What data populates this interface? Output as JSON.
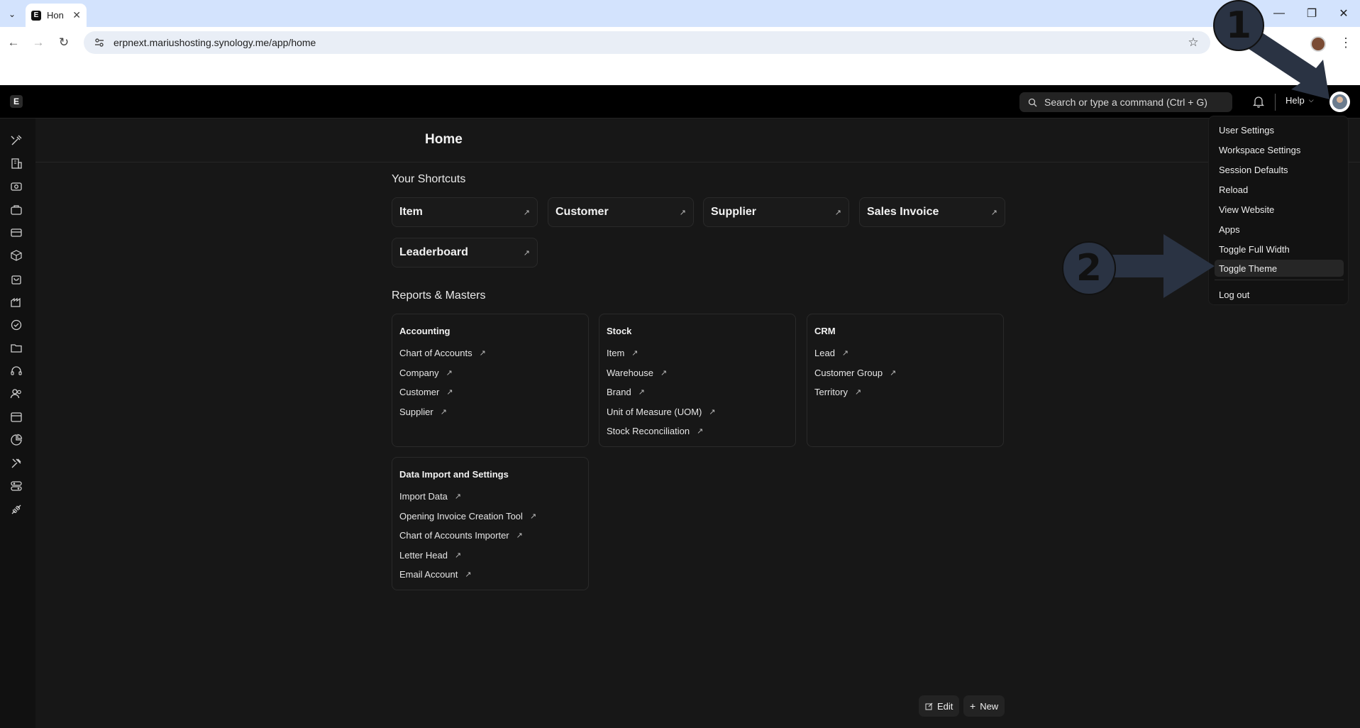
{
  "browser": {
    "tab_title": "Hon",
    "tab_favicon": "E",
    "url": "erpnext.mariushosting.synology.me/app/home"
  },
  "navbar": {
    "logo": "E",
    "search_placeholder": "Search or type a command (Ctrl + G)",
    "help_label": "Help"
  },
  "page": {
    "title": "Home"
  },
  "shortcuts": {
    "title": "Your Shortcuts",
    "items": [
      "Item",
      "Customer",
      "Supplier",
      "Sales Invoice",
      "Leaderboard"
    ]
  },
  "reports": {
    "title": "Reports & Masters",
    "cards": [
      {
        "title": "Accounting",
        "links": [
          "Chart of Accounts",
          "Company",
          "Customer",
          "Supplier"
        ]
      },
      {
        "title": "Stock",
        "links": [
          "Item",
          "Warehouse",
          "Brand",
          "Unit of Measure (UOM)",
          "Stock Reconciliation"
        ]
      },
      {
        "title": "CRM",
        "links": [
          "Lead",
          "Customer Group",
          "Territory"
        ]
      },
      {
        "title": "Data Import and Settings",
        "links": [
          "Import Data",
          "Opening Invoice Creation Tool",
          "Chart of Accounts Importer",
          "Letter Head",
          "Email Account"
        ]
      }
    ]
  },
  "user_menu": {
    "items": [
      "User Settings",
      "Workspace Settings",
      "Session Defaults",
      "Reload",
      "View Website",
      "Apps",
      "Toggle Full Width",
      "Toggle Theme",
      "Log out"
    ]
  },
  "footer_buttons": {
    "edit": "Edit",
    "new": "New"
  },
  "annotations": {
    "step1": "1",
    "step2": "2",
    "color": "#2a3343"
  }
}
